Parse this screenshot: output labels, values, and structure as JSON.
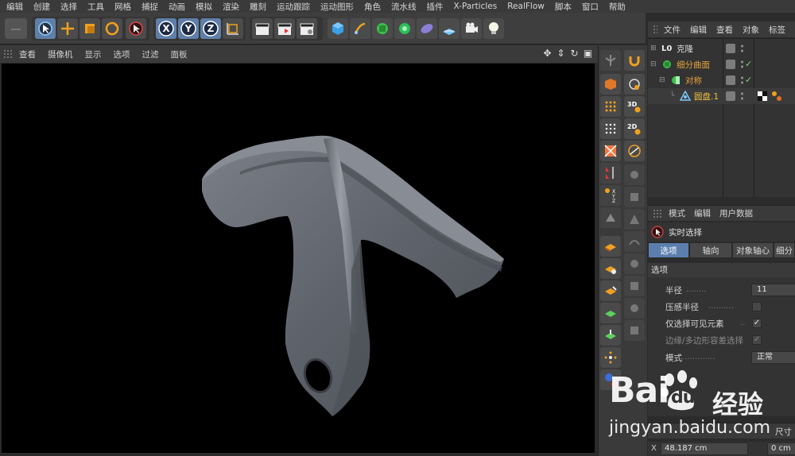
{
  "menu": [
    "编辑",
    "创建",
    "选择",
    "工具",
    "网格",
    "捕捉",
    "动画",
    "模拟",
    "渲染",
    "雕刻",
    "运动跟踪",
    "运动图形",
    "角色",
    "流水线",
    "插件",
    "X-Particles",
    "RealFlow",
    "脚本",
    "窗口",
    "帮助"
  ],
  "toolbar": {
    "axis_x": "X",
    "axis_y": "Y",
    "axis_z": "Z"
  },
  "viewport": {
    "menu": [
      "查看",
      "摄像机",
      "显示",
      "选项",
      "过滤",
      "面板"
    ]
  },
  "object_manager": {
    "menu": [
      "文件",
      "编辑",
      "查看",
      "对象",
      "标签"
    ],
    "objects": [
      {
        "name": "克隆",
        "color": "#d6d6d6"
      },
      {
        "name": "细分曲面",
        "color": "#e8a23a"
      },
      {
        "name": "对称",
        "color": "#e8a23a"
      },
      {
        "name": "圆盘.1",
        "color": "#f0c040"
      }
    ]
  },
  "attribute_manager": {
    "menu": [
      "模式",
      "编辑",
      "用户数据"
    ],
    "tool_name": "实时选择",
    "tabs": [
      "选项",
      "轴向",
      "对象轴心",
      "细分"
    ],
    "active_tab": "选项",
    "section": "选项",
    "props": {
      "radius_label": "半径",
      "radius_value": "11",
      "pressure_label": "压感半径",
      "visible_only_label": "仅选择可见元素",
      "visible_only_check": "✓",
      "edge_poly_label": "边缘/多边形容差选择",
      "edge_poly_check": "✓",
      "mode_label": "模式",
      "mode_value": "正常"
    }
  },
  "coordinates": {
    "size_label": "尺寸",
    "x_label": "X",
    "x_value": "48.187 cm",
    "x2_value": "0 cm"
  },
  "watermark": {
    "logo": "Bai",
    "logo2": "du",
    "cn": "经验",
    "url": "jingyan.baidu.com"
  }
}
